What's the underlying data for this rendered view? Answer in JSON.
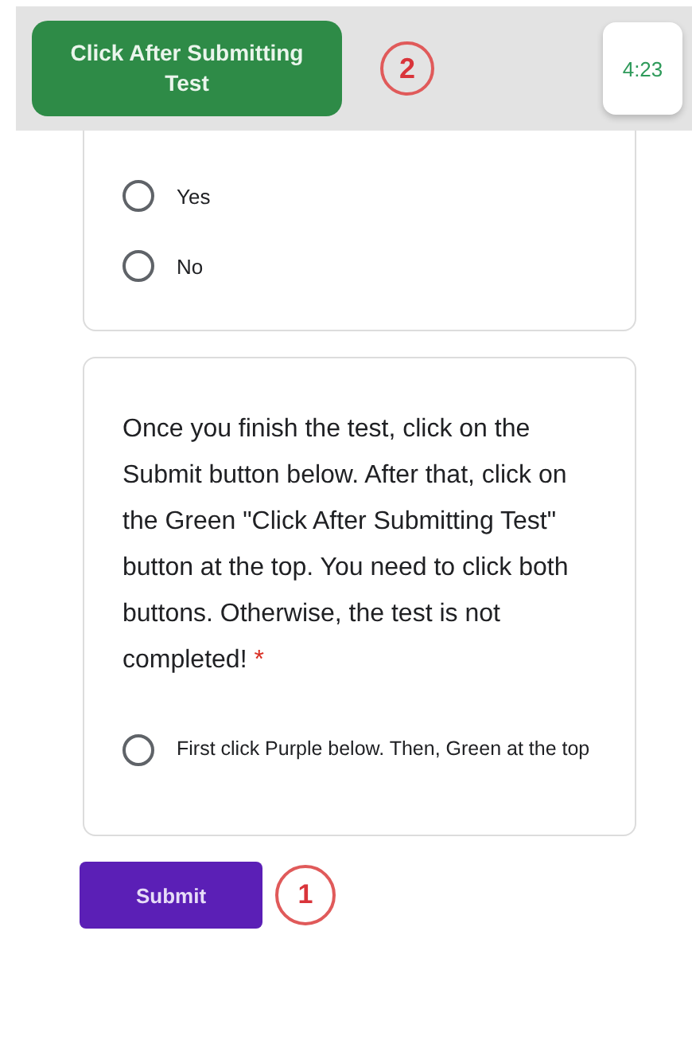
{
  "top_bar": {
    "finish_button": "Click After Submitting Test",
    "step_marker": "2",
    "timer": "4:23"
  },
  "questions": [
    {
      "options": [
        {
          "label": "Yes",
          "selected": false
        },
        {
          "label": "No",
          "selected": false
        }
      ]
    },
    {
      "text": "Once you finish the test, click on the Submit button below. After that, click on the Green \"Click After Submitting Test\" button at the top. You need to click both buttons. Otherwise, the test is not completed!",
      "required_mark": "*",
      "options": [
        {
          "label": "First click Purple below. Then, Green at the top",
          "selected": false
        }
      ]
    }
  ],
  "submit": {
    "label": "Submit",
    "step_marker": "1"
  }
}
